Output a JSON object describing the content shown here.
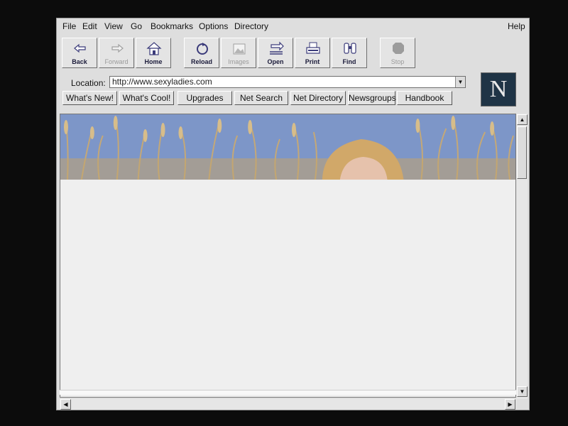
{
  "menu": [
    "File",
    "Edit",
    "View",
    "Go",
    "Bookmarks",
    "Options",
    "Directory"
  ],
  "help_label": "Help",
  "toolbar": {
    "back": "Back",
    "forward": "Forward",
    "home": "Home",
    "reload": "Reload",
    "images": "Images",
    "open": "Open",
    "print": "Print",
    "find": "Find",
    "stop": "Stop"
  },
  "location": {
    "label": "Location:",
    "url": "http://www.sexyladies.com"
  },
  "logo_letter": "N",
  "directory_buttons": [
    "What's New!",
    "What's Cool!",
    "Upgrades",
    "Net Search",
    "Net Directory",
    "Newsgroups",
    "Handbook"
  ],
  "colors": {
    "chrome": "#dedede",
    "sky": "#7d96c8",
    "grass": "#b89a63",
    "logo_bg": "#1f3446"
  }
}
